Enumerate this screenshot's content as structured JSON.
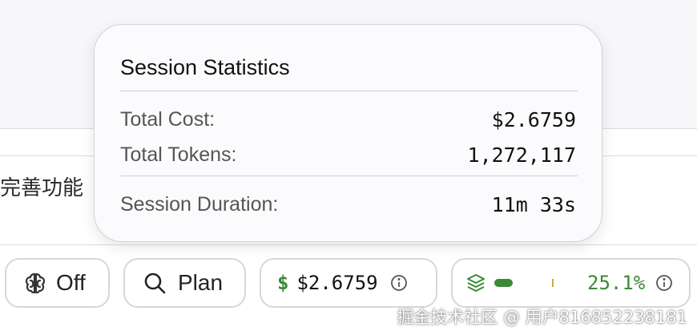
{
  "background": {
    "partial_text": "完善功能"
  },
  "popover": {
    "title": "Session Statistics",
    "rows": [
      {
        "label": "Total Cost:",
        "value": "$2.6759"
      },
      {
        "label": "Total Tokens:",
        "value": "1,272,117"
      },
      {
        "label": "Session Duration:",
        "value": "11m 33s"
      }
    ]
  },
  "toolbar": {
    "thinking": {
      "icon": "brain-icon",
      "label": "Off"
    },
    "mode": {
      "icon": "search-icon",
      "label": "Plan"
    },
    "cost": {
      "icon": "dollar-icon",
      "symbol": "$",
      "value": "$2.6759",
      "info_icon": "info-icon"
    },
    "context": {
      "icon": "layers-icon",
      "percent": "25.1%",
      "fill_fraction": 0.251,
      "info_icon": "info-icon"
    }
  },
  "colors": {
    "green": "#3a8a36",
    "accent_marker": "#d9a23c"
  },
  "watermark": "掘金技术社区 @ 用户816852238181"
}
